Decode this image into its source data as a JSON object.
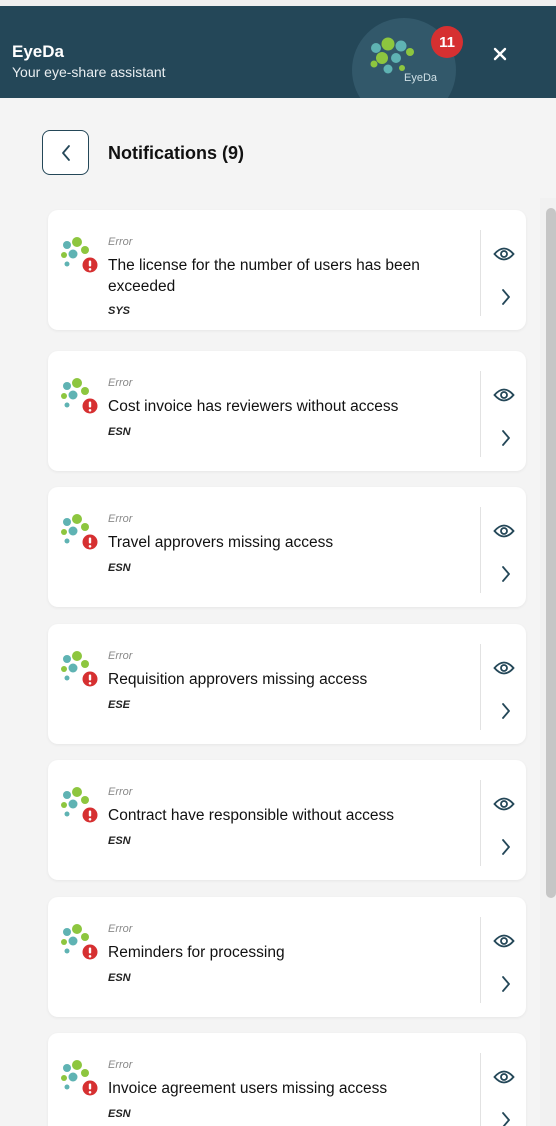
{
  "header": {
    "title": "EyeDa",
    "subtitle": "Your eye-share assistant",
    "logo_text": "EyeDa",
    "badge_count": "11",
    "icons": {
      "close": "close-icon",
      "logo": "eyeda-logo-icon"
    },
    "colors": {
      "header_bg": "#244758",
      "badge": "#d63031"
    }
  },
  "page": {
    "title": "Notifications (9)",
    "back_icon": "chevron-left-icon"
  },
  "notifications": [
    {
      "kind": "Error",
      "message": "The license for the number of users has been exceeded",
      "source": "SYS"
    },
    {
      "kind": "Error",
      "message": "Cost invoice has reviewers without access",
      "source": "ESN"
    },
    {
      "kind": "Error",
      "message": "Travel approvers missing access",
      "source": "ESN"
    },
    {
      "kind": "Error",
      "message": "Requisition approvers missing access",
      "source": "ESE"
    },
    {
      "kind": "Error",
      "message": "Contract have responsible without access",
      "source": "ESN"
    },
    {
      "kind": "Error",
      "message": "Reminders for processing",
      "source": "ESN"
    },
    {
      "kind": "Error",
      "message": "Invoice agreement users missing access",
      "source": "ESN"
    }
  ],
  "card_icons": {
    "status": "error-alert-icon",
    "view": "eye-icon",
    "open": "chevron-right-icon"
  },
  "colors": {
    "error": "#d63031",
    "green": "#8dc63f",
    "teal": "#5fb3b3",
    "accent": "#244758"
  }
}
